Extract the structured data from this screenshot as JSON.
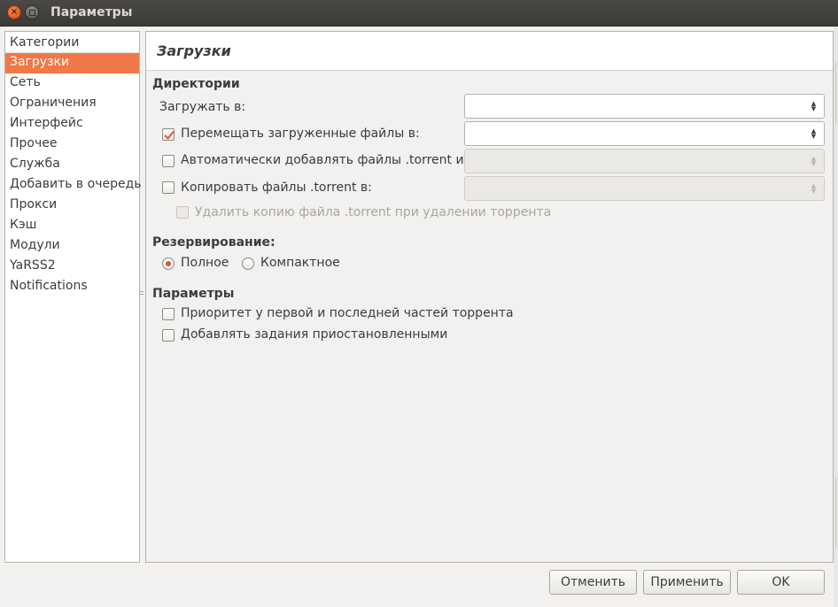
{
  "window": {
    "title": "Параметры",
    "close_glyph": "×",
    "maximize_glyph": ""
  },
  "sidebar": {
    "header": "Категории",
    "items": [
      {
        "label": "Загрузки",
        "selected": true
      },
      {
        "label": "Сеть"
      },
      {
        "label": "Ограничения"
      },
      {
        "label": "Интерфейс"
      },
      {
        "label": "Прочее"
      },
      {
        "label": "Служба"
      },
      {
        "label": "Добавить в очередь"
      },
      {
        "label": "Прокси"
      },
      {
        "label": "Кэш"
      },
      {
        "label": "Модули"
      },
      {
        "label": "YaRSS2"
      },
      {
        "label": "Notifications"
      }
    ]
  },
  "page": {
    "title": "Загрузки",
    "directories": {
      "title": "Директории",
      "download_to_label": "Загружать в:",
      "download_to_value": "",
      "move_completed_label": "Перемещать загруженные файлы в:",
      "move_completed_checked": true,
      "move_completed_value": "",
      "autoadd_label": "Автоматически добавлять файлы .torrent из:",
      "autoadd_checked": false,
      "autoadd_value": "",
      "copy_torrent_label": "Копировать файлы .torrent в:",
      "copy_torrent_checked": false,
      "copy_torrent_value": "",
      "delete_copy_label": "Удалить копию файла .torrent при удалении торрента",
      "delete_copy_checked": false
    },
    "allocation": {
      "title": "Резервирование:",
      "full_label": "Полное",
      "compact_label": "Компактное",
      "selected": "full"
    },
    "options": {
      "title": "Параметры",
      "prioritize_label": "Приоритет у первой и последней частей торрента",
      "prioritize_checked": false,
      "add_paused_label": "Добавлять задания приостановленными",
      "add_paused_checked": false
    }
  },
  "buttons": {
    "cancel": "Отменить",
    "apply": "Применить",
    "ok": "OK"
  },
  "colors": {
    "accent": "#f07746",
    "check": "#e0552a",
    "titlebar": "#3c3b37"
  },
  "icons": {
    "combo_arrows_up": "▲",
    "combo_arrows_down": "▼"
  }
}
